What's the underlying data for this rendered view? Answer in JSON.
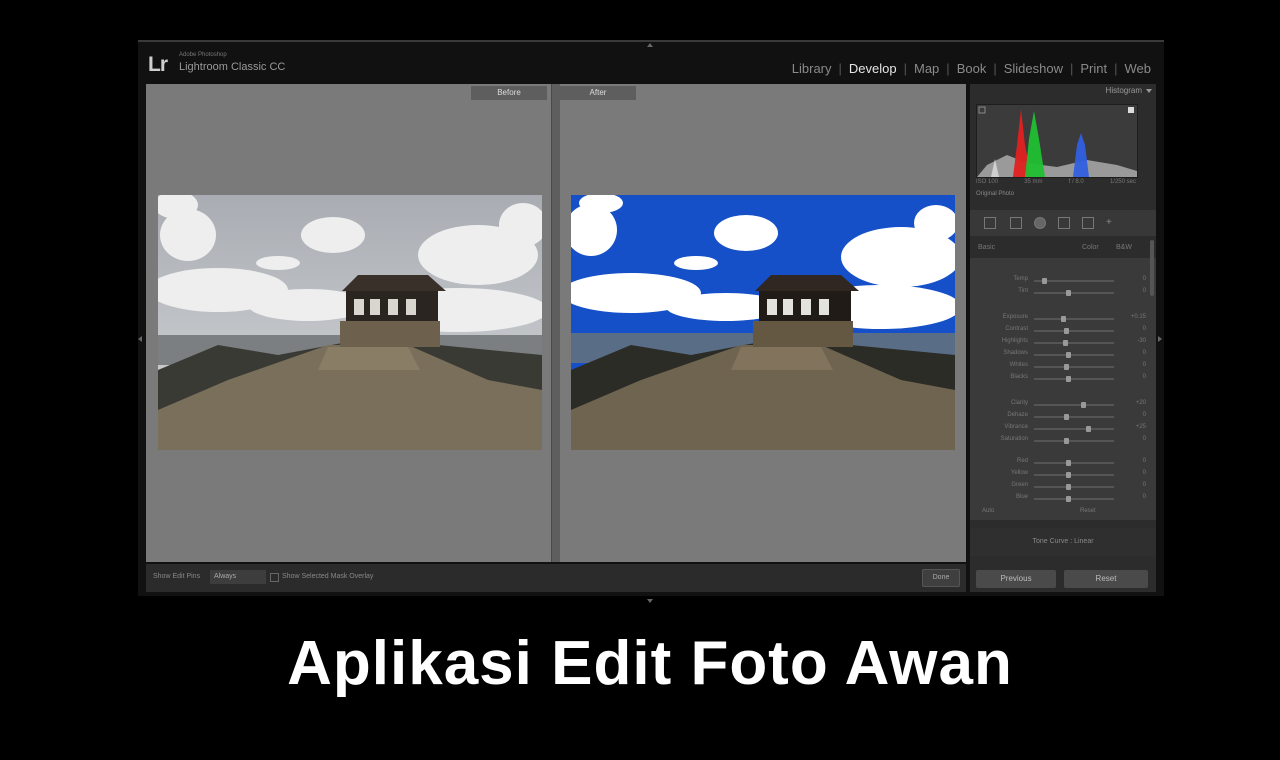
{
  "app": {
    "logo": "Lr",
    "brand_small": "Adobe Photoshop",
    "product": "Lightroom Classic CC",
    "modules": [
      "Library",
      "Develop",
      "Map",
      "Book",
      "Slideshow",
      "Print",
      "Web"
    ],
    "active_module": "Develop"
  },
  "view": {
    "before_label": "Before",
    "after_label": "After"
  },
  "toolbar": {
    "view_label": "Show Edit Pins",
    "mode": "Always",
    "overlay_label": "Show Selected Mask Overlay",
    "done_label": "Done"
  },
  "panel": {
    "histogram_title": "Histogram",
    "histogram_info": [
      "ISO 100",
      "35 mm",
      "f / 8.0",
      "1/250 sec"
    ],
    "original_photo": "Original Photo",
    "basic_tabs": [
      "Basic",
      "Color",
      "B&W"
    ],
    "sliders": [
      {
        "label": "Temp",
        "value": "0",
        "pos": 0.1
      },
      {
        "label": "Tint",
        "value": "0",
        "pos": 0.42
      },
      {
        "label": "Exposure",
        "value": "+0.15",
        "pos": 0.36
      },
      {
        "label": "Contrast",
        "value": "0",
        "pos": 0.4
      },
      {
        "label": "Highlights",
        "value": "-30",
        "pos": 0.38
      },
      {
        "label": "Shadows",
        "value": "0",
        "pos": 0.42
      },
      {
        "label": "Whites",
        "value": "0",
        "pos": 0.4
      },
      {
        "label": "Blacks",
        "value": "0",
        "pos": 0.42
      },
      {
        "label": "Clarity",
        "value": "+20",
        "pos": 0.62
      },
      {
        "label": "Dehaze",
        "value": "0",
        "pos": 0.4
      },
      {
        "label": "Vibrance",
        "value": "+25",
        "pos": 0.68
      },
      {
        "label": "Saturation",
        "value": "0",
        "pos": 0.4
      },
      {
        "label": "Red",
        "value": "0",
        "pos": 0.42
      },
      {
        "label": "Yellow",
        "value": "0",
        "pos": 0.42
      },
      {
        "label": "Green",
        "value": "0",
        "pos": 0.42
      },
      {
        "label": "Blue",
        "value": "0",
        "pos": 0.42
      }
    ],
    "basic_foot_left": "Auto",
    "basic_foot_right": "Reset",
    "tone_curve": "Tone Curve : Linear",
    "previous_label": "Previous",
    "reset_label": "Reset"
  },
  "colors": {
    "sky_after": "#1550c8",
    "sky_before": "#b9bcc0"
  },
  "caption": "Aplikasi Edit Foto Awan"
}
